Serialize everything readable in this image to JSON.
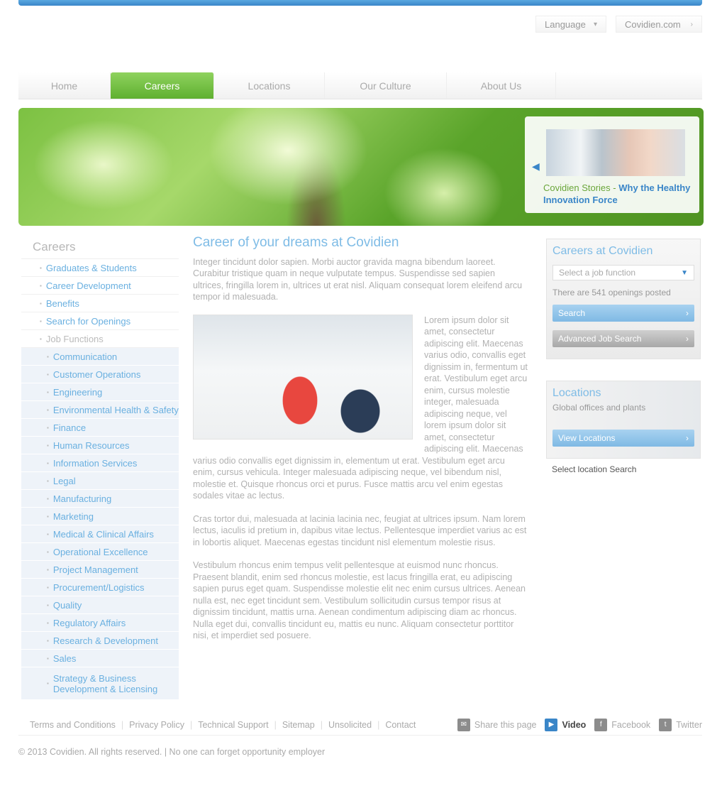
{
  "header": {
    "language_label": "Language",
    "covidien_label": "Covidien.com"
  },
  "nav": {
    "items": [
      "Home",
      "Careers",
      "Locations",
      "Our Culture",
      "About Us"
    ],
    "active_index": 1
  },
  "banner": {
    "feature_caption_lead": "Covidien Stories -",
    "feature_caption_highlight": "Why the Healthy Innovation Force"
  },
  "sidebar": {
    "title": "Careers",
    "items": [
      "Graduates & Students",
      "Career Development",
      "Benefits",
      "Search for Openings"
    ],
    "current_label": "Job Functions",
    "sub_items": [
      "Communication",
      "Customer Operations",
      "Engineering",
      "Environmental Health & Safety",
      "Finance",
      "Human Resources",
      "Information Services",
      "Legal",
      "Manufacturing",
      "Marketing",
      "Medical & Clinical Affairs",
      "Operational Excellence",
      "Project Management",
      "Procurement/Logistics",
      "Quality",
      "Regulatory Affairs",
      "Research & Development",
      "Sales",
      "Strategy & Business Development & Licensing"
    ]
  },
  "main": {
    "title": "Career of your dreams at Covidien",
    "intro": "Integer tincidunt dolor sapien. Morbi auctor gravida magna bibendum laoreet. Curabitur tristique quam in neque vulputate tempus. Suspendisse sed sapien ultrices, fringilla lorem in, ultrices ut erat nisl. Aliquam consequat lorem eleifend arcu tempor id malesuada.",
    "body1": "Lorem ipsum dolor sit amet, consectetur adipiscing elit. Maecenas varius odio, convallis eget dignissim in, fermentum ut erat. Vestibulum eget arcu enim, cursus molestie integer, malesuada adipiscing neque, vel lorem ipsum dolor sit amet, consectetur adipiscing elit. Maecenas varius odio convallis eget dignissim in, elementum ut erat. Vestibulum eget arcu enim, cursus vehicula. Integer malesuada adipiscing neque, vel bibendum nisl, molestie et. Quisque rhoncus orci et purus. Fusce mattis arcu vel enim egestas sodales vitae ac lectus.",
    "body2": "Cras tortor dui, malesuada at lacinia lacinia nec, feugiat at ultrices ipsum. Nam lorem lectus, iaculis id pretium in, dapibus vitae lectus. Pellentesque imperdiet varius ac est in lobortis aliquet. Maecenas egestas tincidunt nisl elementum molestie risus.",
    "body3": "Vestibulum rhoncus enim tempus velit pellentesque at euismod nunc rhoncus. Praesent blandit, enim sed rhoncus molestie, est lacus fringilla erat, eu adipiscing sapien purus eget quam. Suspendisse molestie elit nec enim cursus ultrices. Aenean nulla est, nec eget tincidunt sem. Vestibulum sollicitudin cursus tempor risus at dignissim tincidunt, mattis urna. Aenean condimentum adipiscing diam ac rhoncus. Nulla eget dui, convallis tincidunt eu, mattis eu nunc. Aliquam consectetur porttitor nisi, et imperdiet sed posuere."
  },
  "careers_box": {
    "title": "Careers at Covidien",
    "select_placeholder": "Select a job function",
    "openings_text": "There are 541 openings posted",
    "search_button": "Search",
    "advanced_button": "Advanced Job Search"
  },
  "locations_box": {
    "title": "Locations",
    "subtitle": "Global offices and plants",
    "button": "View Locations",
    "under_left": "Select location",
    "under_right": "Search"
  },
  "footer": {
    "links": [
      "Terms and Conditions",
      "Privacy Policy",
      "Technical Support",
      "Sitemap",
      "Unsolicited",
      "Contact"
    ],
    "share_label": "Share this page",
    "social": [
      "Video",
      "Facebook",
      "Twitter"
    ],
    "copyright": "© 2013 Covidien. All rights reserved. | No one can forget opportunity employer"
  }
}
